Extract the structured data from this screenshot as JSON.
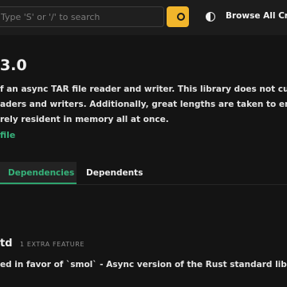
{
  "header": {
    "search_placeholder": "Type 'S' or '/' to search",
    "browse_label": "Browse All Crates"
  },
  "crate": {
    "version": "3.0",
    "description_lines": [
      "f an async TAR file reader and writer. This library does not currently ha",
      "aders and writers. Additionally, great lengths are taken to ensure that",
      "rely resident in memory all at once."
    ],
    "readme_link": "file"
  },
  "tabs": [
    {
      "label": "Dependencies",
      "active": true
    },
    {
      "label": "Dependents",
      "active": false
    }
  ],
  "dependency": {
    "name": "td",
    "feature_badge": "1 EXTRA FEATURE",
    "description": "ed in favor of `smol` - Async version of the Rust standard library"
  },
  "colors": {
    "accent_green": "#36b37a",
    "search_button": "#f1b52b",
    "background": "#141414"
  },
  "icons": {
    "search_button_icon": "search-icon",
    "theme_toggle_icon": "contrast-icon"
  }
}
